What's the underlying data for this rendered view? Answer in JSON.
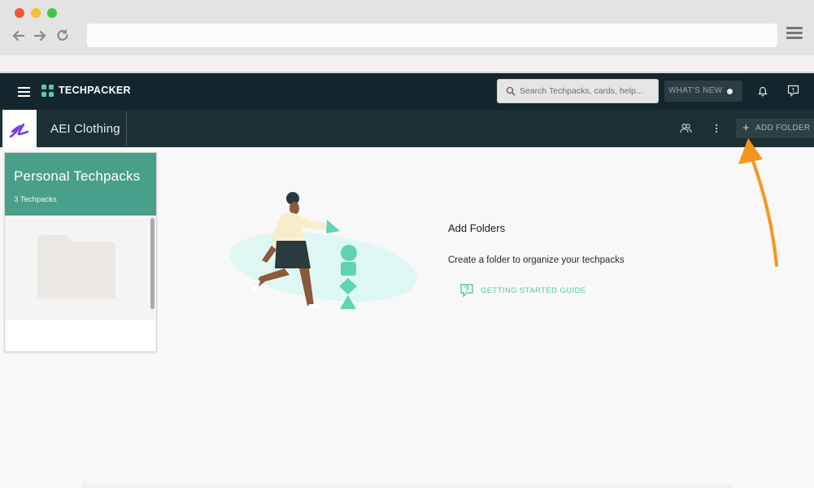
{
  "app": {
    "brand_name": "TECHPACKER",
    "search_placeholder": "Search Techpacks, cards, help...",
    "whats_new_label": "WHAT'S NEW"
  },
  "workspace": {
    "name": "AEI Clothing",
    "add_folder_label": "ADD FOLDER"
  },
  "folder_card": {
    "title": "Personal Techpacks",
    "count_label": "3 Techpacks"
  },
  "empty_state": {
    "title": "Add Folders",
    "description": "Create a folder to organize your techpacks",
    "guide_link_label": "GETTING STARTED GUIDE"
  },
  "colors": {
    "header_bg": "#13262d",
    "subheader_bg": "#1c2f35",
    "card_accent": "#4a9f8a",
    "link_accent": "#55c8a9",
    "annotation_arrow": "#f7941d"
  }
}
